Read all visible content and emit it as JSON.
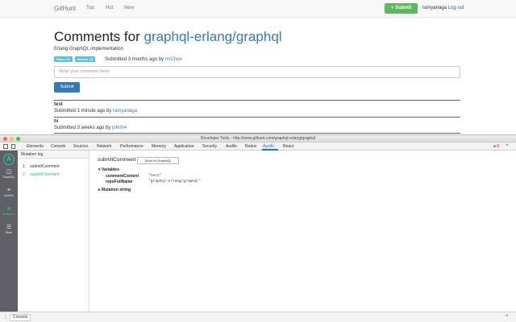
{
  "site": {
    "brand": "GitHunt",
    "nav": [
      "Top",
      "Hot",
      "New"
    ],
    "submit_label": "Submit",
    "username": "ramyanaga",
    "logout_label": "Log out"
  },
  "entry": {
    "title_prefix": "Comments for ",
    "repo_link": "graphql-erlang/graphql",
    "description": "Erlang GraphQL implementation",
    "badges": [
      "Stars: 21",
      "Issues: 13"
    ],
    "submitted_prefix": "Submitted 3 months ago by ",
    "submitted_by": "mrChex"
  },
  "form": {
    "placeholder": "Write your comment here!",
    "submit_label": "Submit"
  },
  "comments": [
    {
      "author": "test",
      "meta_prefix": "Submitted 1 minute ago by ",
      "user": "ramyanaga"
    },
    {
      "author": "hi",
      "meta_prefix": "Submitted 3 weeks ago by ",
      "user": "johnh4"
    }
  ],
  "devtools": {
    "title": "Developer Tools - http://www.githunt.com/graphql-erlang/graphql",
    "tabs": [
      "Elements",
      "Console",
      "Sources",
      "Network",
      "Performance",
      "Memory",
      "Application",
      "Security",
      "Audits",
      "Redux",
      "Apollo",
      "React"
    ],
    "active_tab": "Apollo",
    "error_count": "6",
    "close": "×",
    "console_tab": "Console"
  },
  "apollo": {
    "logo": "A",
    "sidebar": [
      {
        "label": "GraphiQL",
        "icon": "graphiql-icon"
      },
      {
        "label": "Queries",
        "icon": "queries-icon"
      },
      {
        "label": "Mutations",
        "icon": "mutations-icon",
        "active": true
      },
      {
        "label": "Store",
        "icon": "store-icon"
      }
    ],
    "mutation_log_title": "Mutation log",
    "mutations": [
      {
        "num": "1.",
        "name": "submitComment"
      },
      {
        "num": "2.",
        "name": "submitComment",
        "selected": true
      }
    ],
    "detail": {
      "title": "submitComment",
      "graphiql_button": "Show in GraphiQL",
      "variables_label": "Variables",
      "variables": [
        {
          "key": "commentContent",
          "value": "\"test\""
        },
        {
          "key": "repoFullName",
          "value": "\"graphql-erlang/graphql\""
        }
      ],
      "mutation_string_label": "Mutation string"
    }
  },
  "colors": {
    "link": "#337ab7",
    "success": "#5cb85c",
    "badge": "#5bc0de",
    "apollo_accent": "#2cc7a6",
    "devtools_active": "#1a73e8"
  }
}
